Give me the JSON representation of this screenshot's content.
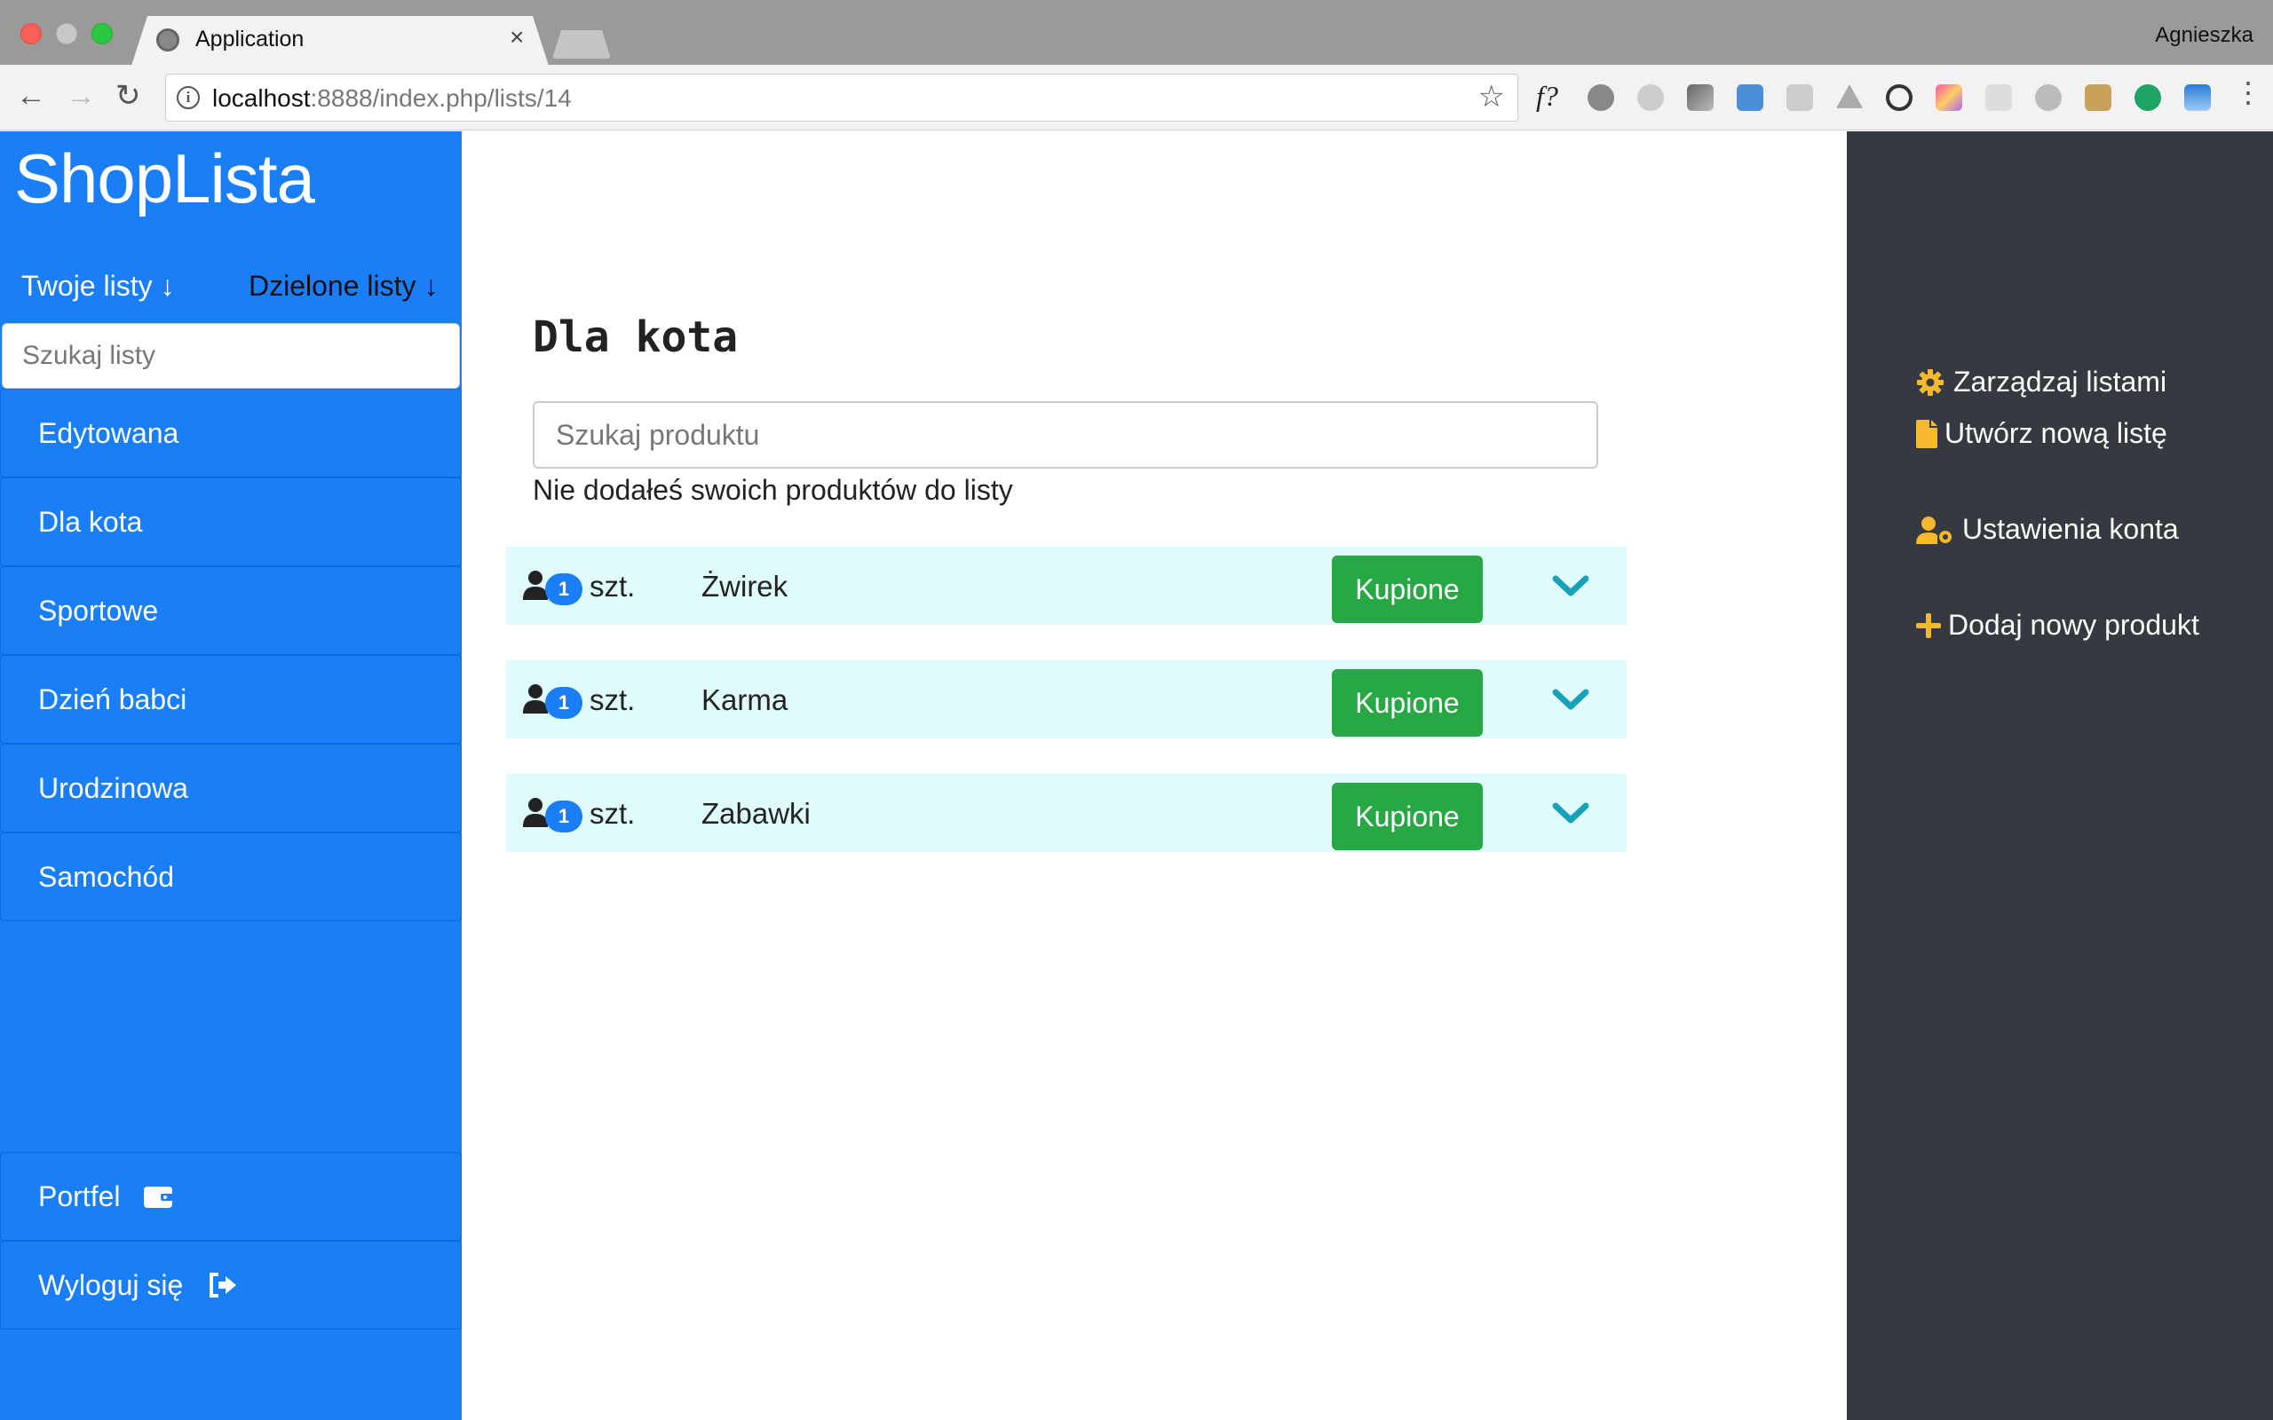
{
  "browser": {
    "tab_title": "Application",
    "tab_close": "×",
    "profile_name": "Agnieszka",
    "url_host": "localhost",
    "url_rest": ":8888/index.php/lists/14",
    "extension_fx": "f?"
  },
  "sidebar": {
    "brand": "ShopLista",
    "tab_own": "Twoje listy",
    "tab_shared": "Dzielone listy",
    "search_placeholder": "Szukaj listy",
    "lists": [
      {
        "label": "Edytowana"
      },
      {
        "label": "Dla kota"
      },
      {
        "label": "Sportowe"
      },
      {
        "label": "Dzień babci"
      },
      {
        "label": "Urodzinowa"
      },
      {
        "label": "Samochód"
      }
    ],
    "wallet_label": "Portfel",
    "logout_label": "Wyloguj się"
  },
  "main": {
    "title": "Dla kota",
    "search_placeholder": "Szukaj produktu",
    "empty_message": "Nie dodałeś swoich produktów do listy",
    "products": [
      {
        "qty": "1",
        "unit": "szt.",
        "name": "Żwirek",
        "buy_label": "Kupione"
      },
      {
        "qty": "1",
        "unit": "szt.",
        "name": "Karma",
        "buy_label": "Kupione"
      },
      {
        "qty": "1",
        "unit": "szt.",
        "name": "Zabawki",
        "buy_label": "Kupione"
      }
    ]
  },
  "right_panel": {
    "manage_lists": "Zarządzaj listami",
    "new_list": "Utwórz nową listę",
    "account_settings": "Ustawienia konta",
    "add_product": "Dodaj nowy produkt"
  },
  "colors": {
    "sidebar_bg": "#1a7ef7",
    "right_panel_bg": "#343a40",
    "row_bg": "#e0fbfc",
    "success": "#28a745",
    "chevron": "#17a2b8",
    "icon_yellow": "#f5b82e"
  }
}
